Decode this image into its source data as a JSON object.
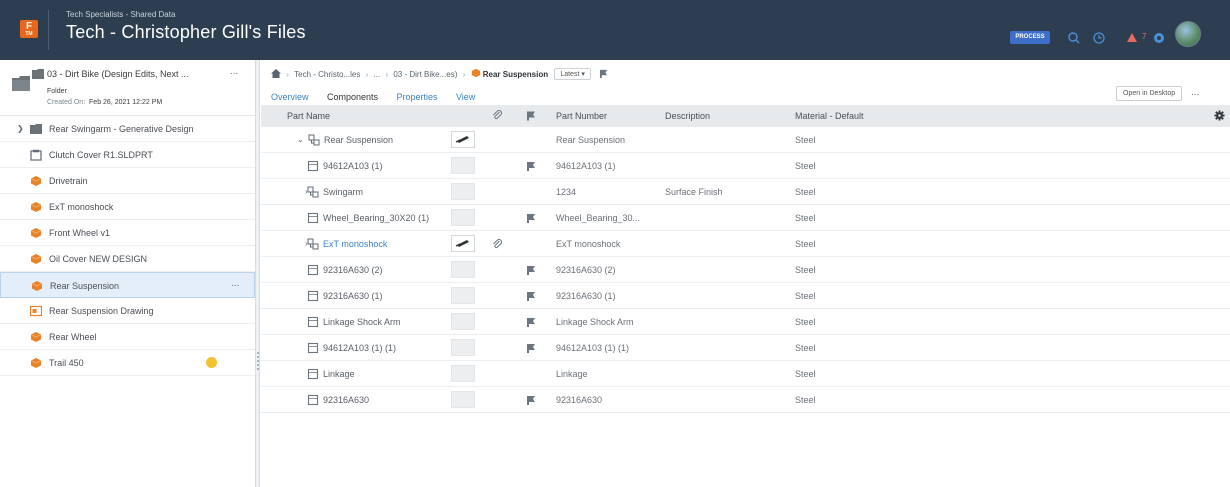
{
  "header": {
    "subtitle": "Tech Specialists - Shared Data",
    "title": "Tech - Christopher Gill's Files",
    "process_label": "PROCESS",
    "notification_count": "7",
    "logo_letter": "F",
    "logo_sub": "TM"
  },
  "sidebar": {
    "folder": {
      "name": "03 - Dirt Bike (Design Edits, Next ...",
      "type": "Folder",
      "created_label": "Created On",
      "created_value": "Feb 26, 2021 12:22 PM",
      "more": "..."
    },
    "items": [
      {
        "label": "Rear Swingarm - Generative Design",
        "icon": "folder-icon",
        "expandable": true
      },
      {
        "label": "Clutch Cover R1.SLDPRT",
        "icon": "file-icon"
      },
      {
        "label": "Drivetrain",
        "icon": "assembly-icon"
      },
      {
        "label": "ExT monoshock",
        "icon": "assembly-icon"
      },
      {
        "label": "Front Wheel v1",
        "icon": "assembly-icon"
      },
      {
        "label": "Oil Cover NEW DESIGN",
        "icon": "assembly-icon"
      },
      {
        "label": "Rear Suspension",
        "icon": "assembly-icon",
        "selected": true,
        "more": "..."
      },
      {
        "label": "Rear Suspension Drawing",
        "icon": "drawing-icon"
      },
      {
        "label": "Rear Wheel",
        "icon": "assembly-icon"
      },
      {
        "label": "Trail 450",
        "icon": "assembly-icon",
        "badge": "clock-badge-icon"
      }
    ]
  },
  "breadcrumb": {
    "items": [
      "Tech - Christo...les",
      "...",
      "03 - Dirt Bike...es)"
    ],
    "current": "Rear Suspension",
    "version": "Latest"
  },
  "tabs": [
    {
      "label": "Overview"
    },
    {
      "label": "Components",
      "active": true
    },
    {
      "label": "Properties"
    },
    {
      "label": "View"
    }
  ],
  "actions": {
    "open_desktop": "Open in Desktop",
    "more": "..."
  },
  "table": {
    "headers": {
      "part_name": "Part Name",
      "part_number": "Part Number",
      "description": "Description",
      "material": "Material - Default"
    },
    "rows": [
      {
        "name": "Rear Suspension",
        "level": 0,
        "type": "assembly",
        "expand": "down",
        "thumb": "shock-thumb",
        "attach": false,
        "flag": false,
        "part_number": "Rear Suspension",
        "description": "",
        "material": "Steel"
      },
      {
        "name": "94612A103 (1)",
        "level": 1,
        "type": "part",
        "thumb": "",
        "attach": false,
        "flag": true,
        "part_number": "94612A103 (1)",
        "description": "",
        "material": "Steel"
      },
      {
        "name": "Swingarm",
        "level": 1,
        "type": "assembly",
        "expand": "right",
        "thumb": "",
        "attach": false,
        "flag": false,
        "part_number": "1234",
        "description": "Surface Finish",
        "material": "Steel"
      },
      {
        "name": "Wheel_Bearing_30X20 (1)",
        "level": 1,
        "type": "part",
        "thumb": "",
        "attach": false,
        "flag": true,
        "part_number": "Wheel_Bearing_30...",
        "description": "",
        "material": "Steel"
      },
      {
        "name": "ExT monoshock",
        "level": 1,
        "type": "assembly",
        "expand": "right",
        "link": true,
        "thumb": "shock-thumb",
        "attach": true,
        "flag": false,
        "part_number": "ExT monoshock",
        "description": "",
        "material": "Steel"
      },
      {
        "name": "92316A630 (2)",
        "level": 1,
        "type": "part",
        "thumb": "",
        "attach": false,
        "flag": true,
        "part_number": "92316A630 (2)",
        "description": "",
        "material": "Steel"
      },
      {
        "name": "92316A630 (1)",
        "level": 1,
        "type": "part",
        "thumb": "",
        "attach": false,
        "flag": true,
        "part_number": "92316A630 (1)",
        "description": "",
        "material": "Steel"
      },
      {
        "name": "Linkage Shock Arm",
        "level": 1,
        "type": "part",
        "thumb": "",
        "attach": false,
        "flag": true,
        "part_number": "Linkage Shock Arm",
        "description": "",
        "material": "Steel"
      },
      {
        "name": "94612A103 (1) (1)",
        "level": 1,
        "type": "part",
        "thumb": "",
        "attach": false,
        "flag": true,
        "part_number": "94612A103 (1) (1)",
        "description": "",
        "material": "Steel"
      },
      {
        "name": "Linkage",
        "level": 1,
        "type": "part",
        "thumb": "",
        "attach": false,
        "flag": false,
        "part_number": "Linkage",
        "description": "",
        "material": "Steel"
      },
      {
        "name": "92316A630",
        "level": 1,
        "type": "part",
        "thumb": "",
        "attach": false,
        "flag": true,
        "part_number": "92316A630",
        "description": "",
        "material": "Steel"
      }
    ]
  },
  "colors": {
    "header_bg": "#2c3e50",
    "accent_blue": "#3d82c9",
    "assembly_orange": "#e8832a",
    "selected_bg": "#e3eef8",
    "process_badge": "#3d6ec9",
    "alert_red": "#e36c5b",
    "badge_yellow": "#f2c22c"
  }
}
